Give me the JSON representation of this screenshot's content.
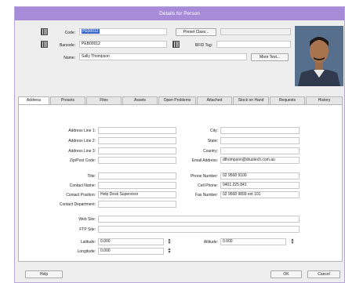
{
  "window": {
    "title": "Details for Person"
  },
  "header": {
    "code_label": "Code:",
    "code_value": "PE00012",
    "preset_class_button": "Preset Class...",
    "barcode_label": "Barcode:",
    "barcode_value": "PEB00012",
    "rfid_label": "RFID Tag:",
    "name_label": "Name:",
    "name_value": "Sally Thompson",
    "more_text_button": "More Text..."
  },
  "tabs": [
    "Address",
    "Presets",
    "Files",
    "Assets",
    "Open Problems",
    "Attached",
    "Stock on Hand",
    "Requests",
    "History"
  ],
  "address": {
    "line1_label": "Address Line 1:",
    "line2_label": "Address Line 2:",
    "line3_label": "Address Line 3:",
    "zip_label": "Zip/Post Code:",
    "city_label": "City:",
    "state_label": "State:",
    "country_label": "Country:",
    "email_label": "Email Address:",
    "email_value": "dthompson@drustech.com.au"
  },
  "contact": {
    "title_label": "Title:",
    "contact_name_label": "Contact Name:",
    "contact_position_label": "Contact Position:",
    "contact_position_value": "Help Desk Supervisor",
    "contact_department_label": "Contact Department:",
    "phone_label": "Phone Number:",
    "phone_value": "02 9568 9100",
    "cell_label": "Cell Phone:",
    "cell_value": "0401 225 841",
    "fax_label": "Fax Number:",
    "fax_value": "02 9568 9899 ext 101"
  },
  "web": {
    "website_label": "Web Site:",
    "ftp_label": "FTP Site:"
  },
  "location": {
    "latitude_label": "Latitude:",
    "latitude_value": "0.000",
    "longitude_label": "Longitude:",
    "longitude_value": "0.000",
    "altitude_label": "Altitude:",
    "altitude_value": "0.000"
  },
  "footer": {
    "help_button": "Help",
    "ok_button": "OK",
    "cancel_button": "Cancel"
  }
}
